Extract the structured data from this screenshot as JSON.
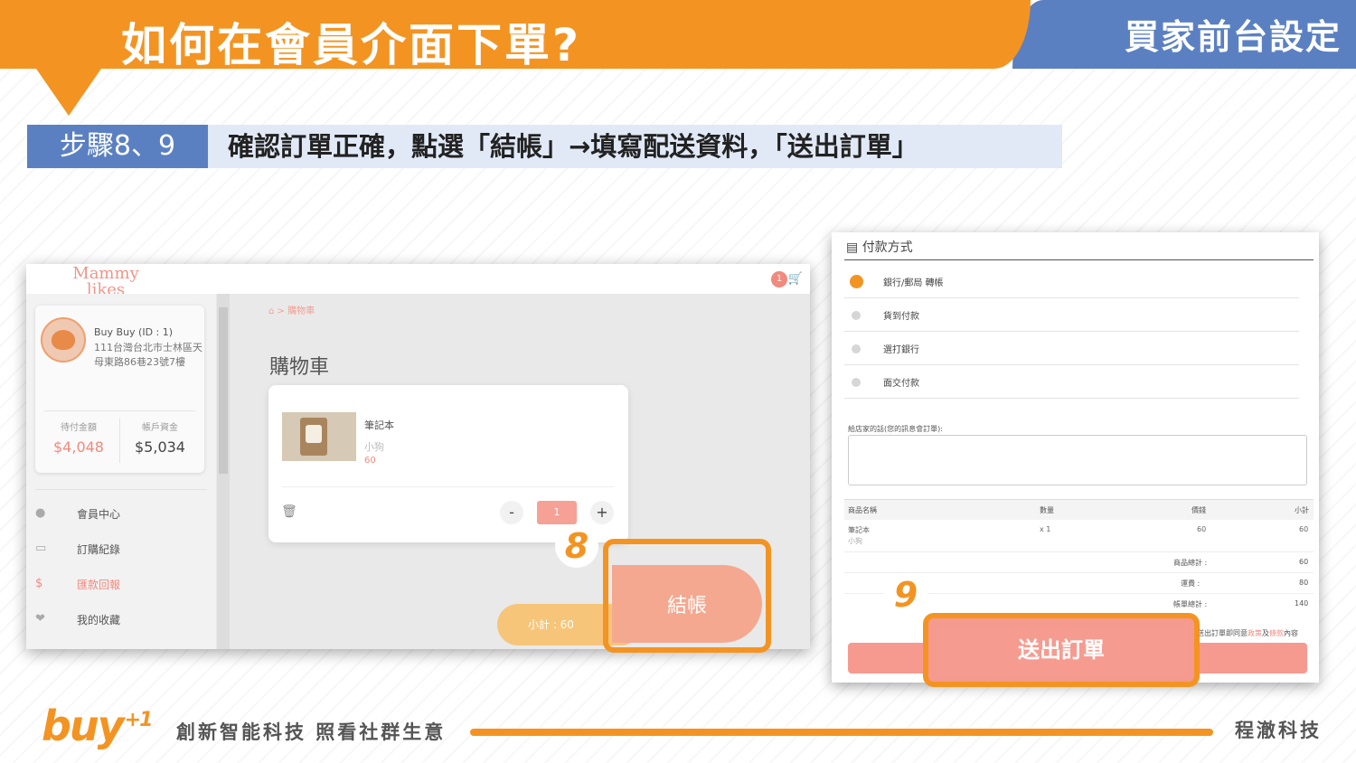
{
  "header": {
    "title": "如何在會員介面下單?",
    "section": "買家前台設定"
  },
  "step": {
    "badge": "步驟8、9",
    "text": "確認訂單正確，點選「結帳」→填寫配送資料，「送出訂單」"
  },
  "cart_screen": {
    "logo": "Mammy likes shopping",
    "cart_count": "1",
    "profile": {
      "name": "Buy Buy (ID : 1)",
      "address": "111台灣台北市士林區天母東路86巷23號7樓",
      "stats": [
        {
          "label": "待付金額",
          "value": "$4,048",
          "color": "#f08a7e"
        },
        {
          "label": "帳戶資金",
          "value": "$5,034",
          "color": "#444444"
        }
      ]
    },
    "menu": [
      {
        "icon": "user-icon",
        "label": "會員中心"
      },
      {
        "icon": "card-icon",
        "label": "訂購紀錄"
      },
      {
        "icon": "dollar-icon",
        "label": "匯款回報"
      },
      {
        "icon": "heart-icon",
        "label": "我的收藏"
      }
    ],
    "breadcrumb": "購物車",
    "title": "購物車",
    "item": {
      "name": "筆記本",
      "variant": "小狗",
      "price": "60",
      "qty": "1"
    },
    "subtotal": "小計 : 60",
    "checkout": "結帳",
    "marker": "8"
  },
  "checkout_screen": {
    "payment_title": "付款方式",
    "payment_options": [
      "銀行/郵局 轉帳",
      "貨到付款",
      "選打銀行",
      "面交付款"
    ],
    "selected_payment": 0,
    "note_label": "給店家的話(您的訊息會訂單):",
    "table": {
      "headers": [
        "商品名稱",
        "數量",
        "價錢",
        "小計"
      ],
      "rows": [
        [
          "筆記本",
          "x 1",
          "60",
          "60"
        ]
      ],
      "row_sub": "小狗"
    },
    "summary": [
      {
        "label": "商品總計 :",
        "value": "60"
      },
      {
        "label": "運費 :",
        "value": "80"
      },
      {
        "label": "帳單總計 :",
        "value": "140"
      }
    ],
    "agree": {
      "prefix": "送出訂單即同意",
      "link1": "政策",
      "mid": "及",
      "link2": "條款",
      "suffix": "內容"
    },
    "submit": "送出訂單",
    "marker": "9"
  },
  "footer": {
    "logo": "buy",
    "logo_sup": "+1",
    "slogan": "創新智能科技 照看社群生意",
    "company": "程澈科技"
  }
}
